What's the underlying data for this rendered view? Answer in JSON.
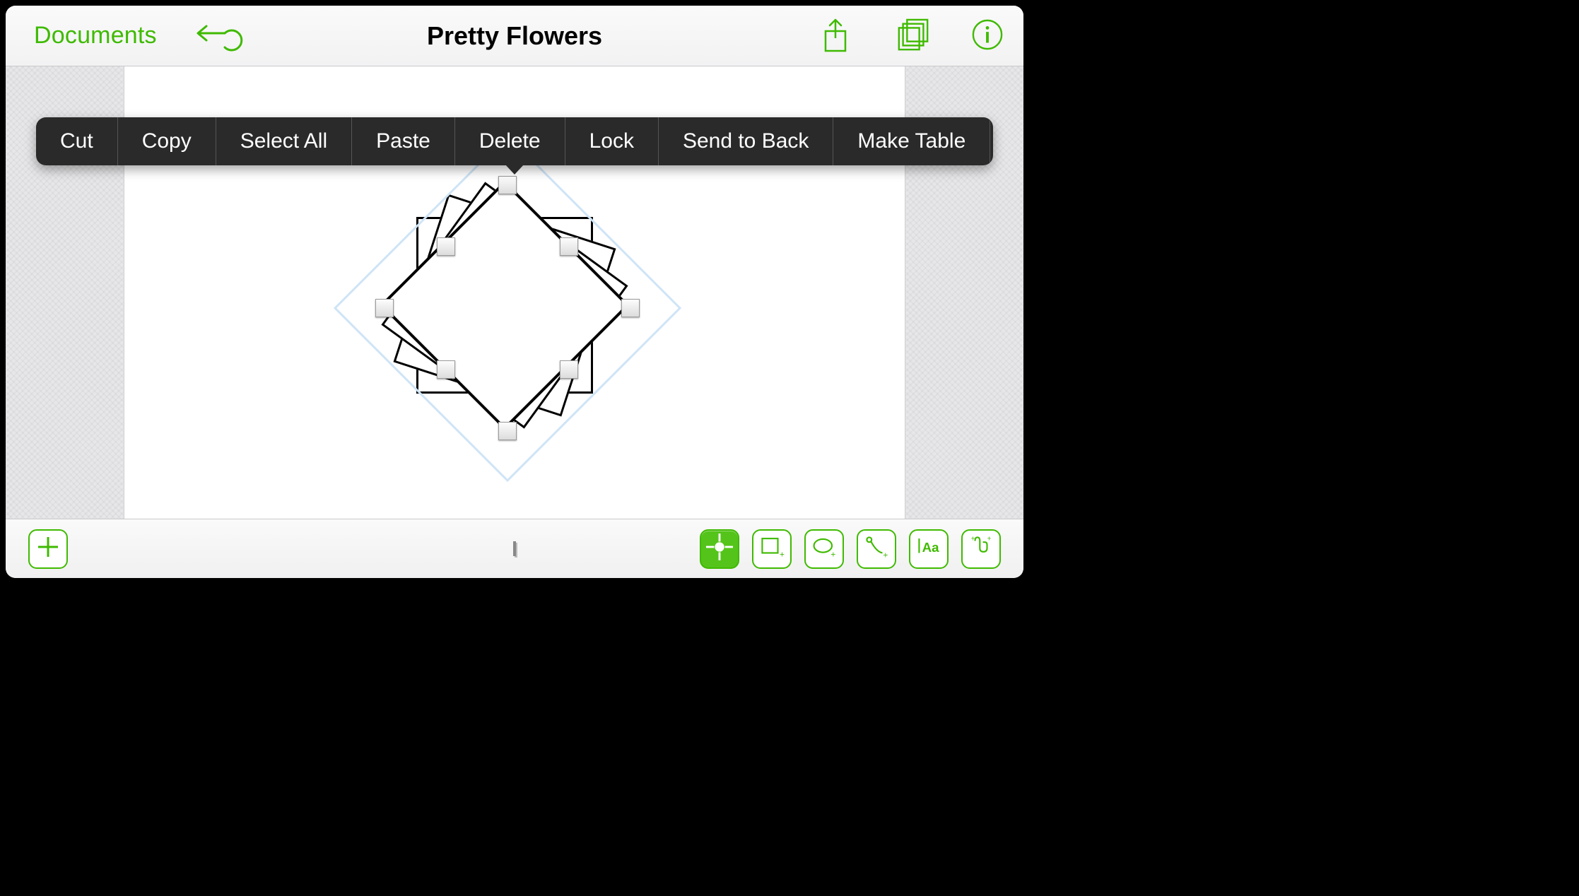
{
  "colors": {
    "accent": "#3fba00",
    "menu_bg": "#2a2a2a"
  },
  "header": {
    "back_label": "Documents",
    "title": "Pretty Flowers",
    "icons": {
      "undo": "undo-icon",
      "share": "share-icon",
      "stencils": "stencils-icon",
      "info": "info-icon"
    }
  },
  "context_menu": {
    "items": [
      "Cut",
      "Copy",
      "Select All",
      "Paste",
      "Delete",
      "Lock",
      "Send to Back",
      "Make Table"
    ],
    "more_icon": "chevron-right-icon"
  },
  "bottom_toolbar": {
    "left": {
      "add": "plus-icon"
    },
    "center": {
      "indicator": "diamond-indicator-icon"
    },
    "right_tools": [
      {
        "name": "target-tool",
        "icon": "target-icon",
        "active": true
      },
      {
        "name": "rectangle-tool",
        "icon": "rectangle-icon",
        "active": false
      },
      {
        "name": "ellipse-tool",
        "icon": "ellipse-icon",
        "active": false
      },
      {
        "name": "line-tool",
        "icon": "line-icon",
        "active": false
      },
      {
        "name": "text-tool",
        "icon": "text-icon",
        "active": false
      },
      {
        "name": "touch-tool",
        "icon": "touch-icon",
        "active": false
      }
    ]
  },
  "canvas": {
    "selected_object": "rotated-square-stack",
    "selection_handles": 8
  }
}
